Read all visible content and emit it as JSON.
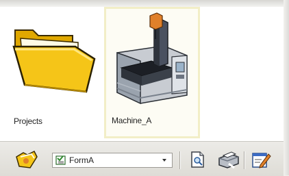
{
  "items": [
    {
      "label": "Projects",
      "icon": "folder-icon"
    },
    {
      "label": "Machine_A",
      "icon": "machine-icon"
    }
  ],
  "toolbar": {
    "form_select": {
      "value": "FormA",
      "icon": "form-icon"
    }
  },
  "colors": {
    "selection_border": "#f2eec7",
    "folder": "#f5c518"
  }
}
